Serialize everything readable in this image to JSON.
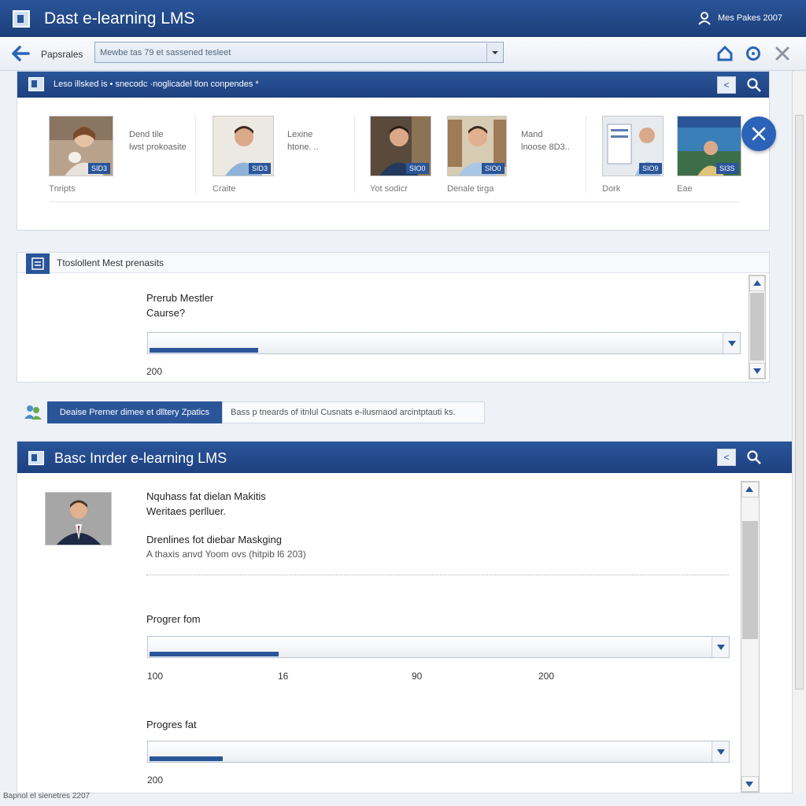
{
  "app": {
    "title": "Dast e-learning LMS",
    "user": "Mes Pakes 2007"
  },
  "toolbar": {
    "nav_label": "Papsrales",
    "address_value": "Mewbe tas 79 et sassened tesleet"
  },
  "panel1": {
    "header": "Leso illsked is • snecodc ·noglicadel tlon conpendes *",
    "cards": [
      {
        "badge": "SID3",
        "label": "Tnripts",
        "caption_lines": [
          "Dend tile",
          "lwst prokoasite"
        ]
      },
      {
        "badge": "SID3",
        "label": "Craite",
        "caption_lines": [
          "Lexine",
          "htone. .."
        ]
      },
      {
        "badge": "SIO0",
        "label": "Yot sodicr"
      },
      {
        "badge": "SIO0",
        "label": "Denale tirga",
        "caption_lines": [
          "Mand",
          "lnoose 8D3.."
        ]
      },
      {
        "badge": "SIO9",
        "label": "Dork"
      },
      {
        "badge": "SI3S",
        "label": "Eae"
      }
    ]
  },
  "panel2": {
    "header": "Ttoslollent Mest prenasits",
    "question": [
      "Prerub Mestler",
      "Caurse?"
    ],
    "value": "200",
    "progress": 0.19
  },
  "tabs": {
    "active": "Deaise Prerner dimee et dlltery Zpatics",
    "inactive": "Bass p tneards of itnlul Cusnats e-ilusmaod arcintptauti ks."
  },
  "panel3": {
    "header": "Basc Inrder e-learning LMS",
    "line1": [
      "Nquhass fat dielan Makitis",
      "Weritaes perlluer."
    ],
    "line2": [
      "Drenlines fot diebar Maskging",
      "A thaxis anvd Yoom ovs (hitpib l6 203)"
    ],
    "progress1": {
      "label": "Progrer fom",
      "fill": 0.23,
      "ticks": [
        "100",
        "16",
        "90",
        "200"
      ]
    },
    "progress2": {
      "label": "Progres fat",
      "fill": 0.13,
      "value": "200"
    }
  },
  "footer": "Bapnol el sienetres 2207",
  "colors": {
    "brand": "#2a5599",
    "accent": "#2b63b8"
  }
}
